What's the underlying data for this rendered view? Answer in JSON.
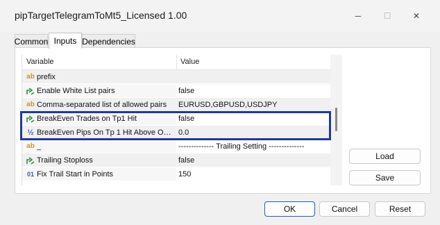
{
  "window": {
    "title": "pipTargetTelegramToMt5_Licensed 1.00",
    "minimize_glyph": "─",
    "maximize_glyph": "☐",
    "close_glyph": "✕"
  },
  "tabs": [
    {
      "label": "Common",
      "active": false
    },
    {
      "label": "Inputs",
      "active": true
    },
    {
      "label": "Dependencies",
      "active": false
    }
  ],
  "grid": {
    "columns": {
      "variable": "Variable",
      "value": "Value"
    },
    "rows": [
      {
        "icon": "string-icon",
        "glyph": "ab",
        "name": "prefix",
        "value": "",
        "shade": "grey"
      },
      {
        "icon": "bool-icon",
        "glyph": "",
        "name": "Enable White List pairs",
        "value": "false",
        "shade": "alt"
      },
      {
        "icon": "string-icon",
        "glyph": "ab",
        "name": "Comma-separated list of allowed pairs",
        "value": "EURUSD,GBPUSD,USDJPY",
        "shade": "grey"
      },
      {
        "icon": "bool-icon",
        "glyph": "",
        "name": "BreakEven Trades on Tp1 Hit",
        "value": "false",
        "shade": "alt"
      },
      {
        "icon": "double-icon",
        "glyph": "½",
        "name": "BreakEven Pips On Tp 1 Hit Above Op…",
        "value": "0.0",
        "shade": "grey"
      },
      {
        "icon": "string-icon",
        "glyph": "ab",
        "name": "_",
        "value": "-------------- Trailing Setting --------------",
        "shade": "alt"
      },
      {
        "icon": "bool-icon",
        "glyph": "",
        "name": "Trailing Stoploss",
        "value": "false",
        "shade": "grey"
      },
      {
        "icon": "int-icon",
        "glyph": "01",
        "name": "Fix Trail Start in Points",
        "value": "150",
        "shade": "alt"
      }
    ]
  },
  "side_buttons": {
    "load": "Load",
    "save": "Save"
  },
  "footer_buttons": {
    "ok": "OK",
    "cancel": "Cancel",
    "reset": "Reset"
  },
  "colors": {
    "highlight_border": "#1e3a9f",
    "bool_icon_green": "#2e8b3a",
    "string_icon_orange": "#c8923a",
    "number_icon_blue": "#3a5ba8"
  }
}
